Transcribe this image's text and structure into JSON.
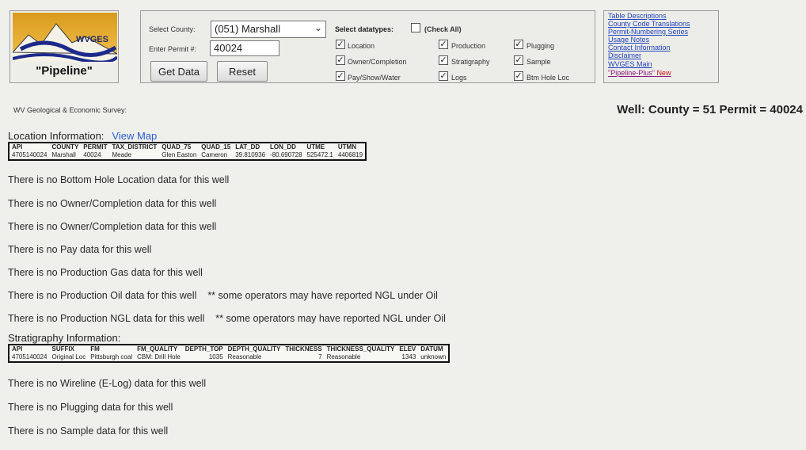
{
  "logo": {
    "brand": "WVGES",
    "name": "\"Pipeline\""
  },
  "form": {
    "county_label": "Select County:",
    "county_value": "(051) Marshall",
    "permit_label": "Enter Permit #:",
    "permit_value": "40024",
    "get_data": "Get Data",
    "reset": "Reset",
    "datatypes_title": "Select datatypes:",
    "check_all": "(Check All)",
    "checkboxes": [
      {
        "label": "Location",
        "checked": true
      },
      {
        "label": "Owner/Completion",
        "checked": true
      },
      {
        "label": "Pay/Show/Water",
        "checked": true
      },
      {
        "label": "Production",
        "checked": true
      },
      {
        "label": "Stratigraphy",
        "checked": true
      },
      {
        "label": "Logs",
        "checked": true
      },
      {
        "label": "Plugging",
        "checked": true
      },
      {
        "label": "Sample",
        "checked": true
      },
      {
        "label": "Btm Hole Loc",
        "checked": true
      }
    ]
  },
  "links": [
    "Table Descriptions",
    "County Code Translations",
    "Permit-Numbering Series",
    "Usage Notes",
    "Contact Information",
    "Disclaimer",
    "WVGES Main",
    "\"Pipeline-Plus\""
  ],
  "links_new": "New",
  "survey": "WV Geological & Economic Survey:",
  "well_title": "Well:  County = 51 Permit = 40024",
  "location": {
    "title": "Location Information:",
    "map_link": "View Map",
    "headers": [
      "API",
      "COUNTY",
      "PERMIT",
      "TAX_DISTRICT",
      "QUAD_75",
      "QUAD_15",
      "LAT_DD",
      "LON_DD",
      "UTME",
      "UTMN"
    ],
    "row": [
      "4705140024",
      "Marshall",
      "40024",
      "Meade",
      "Glen Easton",
      "Cameron",
      "39.810936",
      "-80.690728",
      "525472.1",
      "4406819"
    ]
  },
  "notes_a": [
    "There is no Bottom Hole Location data for this well",
    "There is no Owner/Completion data for this well",
    "There is no Owner/Completion data for this well",
    "There is no Pay data for this well",
    "There is no Production Gas data for this well"
  ],
  "notes_b": [
    {
      "text": "There is no Production Oil data for this well",
      "extra": "** some operators may have reported NGL under Oil"
    },
    {
      "text": "There is no Production NGL data for this well",
      "extra": "** some operators may have reported NGL under Oil"
    }
  ],
  "strat": {
    "title": "Stratigraphy Information:",
    "headers": [
      "API",
      "SUFFIX",
      "FM",
      "FM_QUALITY",
      "DEPTH_TOP",
      "DEPTH_QUALITY",
      "THICKNESS",
      "THICKNESS_QUALITY",
      "ELEV",
      "DATUM"
    ],
    "row": [
      "4705140024",
      "Original Loc",
      "Pittsburgh coal",
      "CBM: Drill Hole",
      "1035",
      "Reasonable",
      "7",
      "Reasonable",
      "1343",
      "unknown"
    ]
  },
  "notes_c": [
    "There is no Wireline (E-Log) data for this well",
    "There is no Plugging data for this well",
    "There is no Sample data for this well"
  ]
}
